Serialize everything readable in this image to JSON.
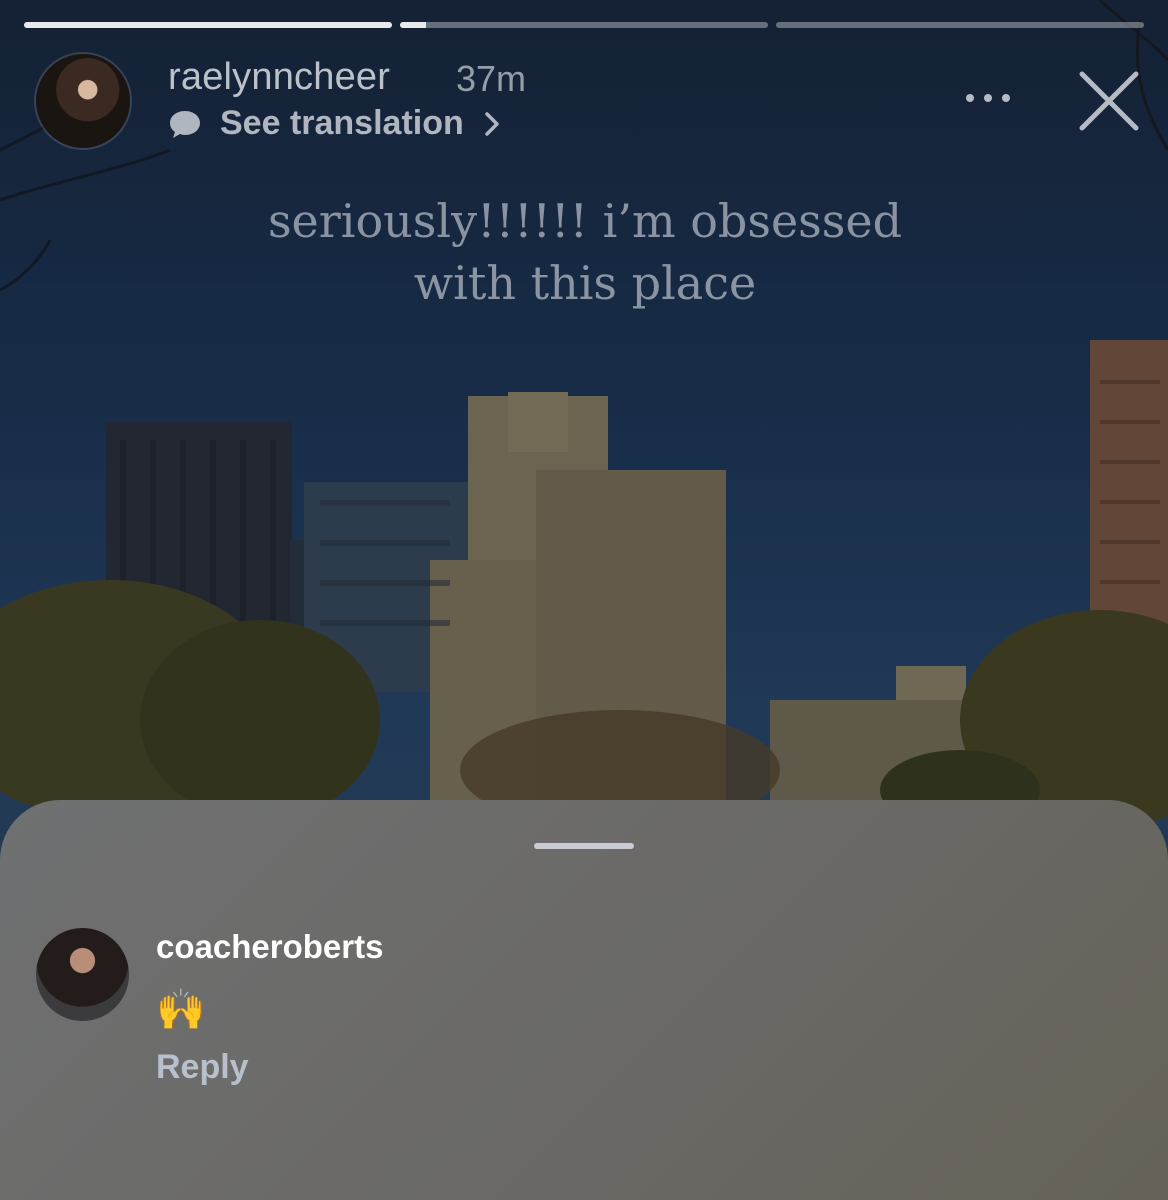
{
  "story": {
    "progress": [
      1.0,
      0.07,
      0.0
    ],
    "author": "raelynncheer",
    "time": "37m",
    "translate_label": "See translation",
    "caption_line1": "seriously!!!!!! i’m obsessed",
    "caption_line2": "with this place"
  },
  "icons": {
    "more": "more-horizontal-icon",
    "close": "close-icon",
    "translate": "speech-bubble-icon",
    "chevron": "chevron-right-icon"
  },
  "comment": {
    "username": "coacheroberts",
    "text": "🙌",
    "reply_label": "Reply"
  },
  "colors": {
    "sheet": "#6a6966",
    "handle": "#c9cdd3",
    "reply": "#b8c0cc"
  }
}
